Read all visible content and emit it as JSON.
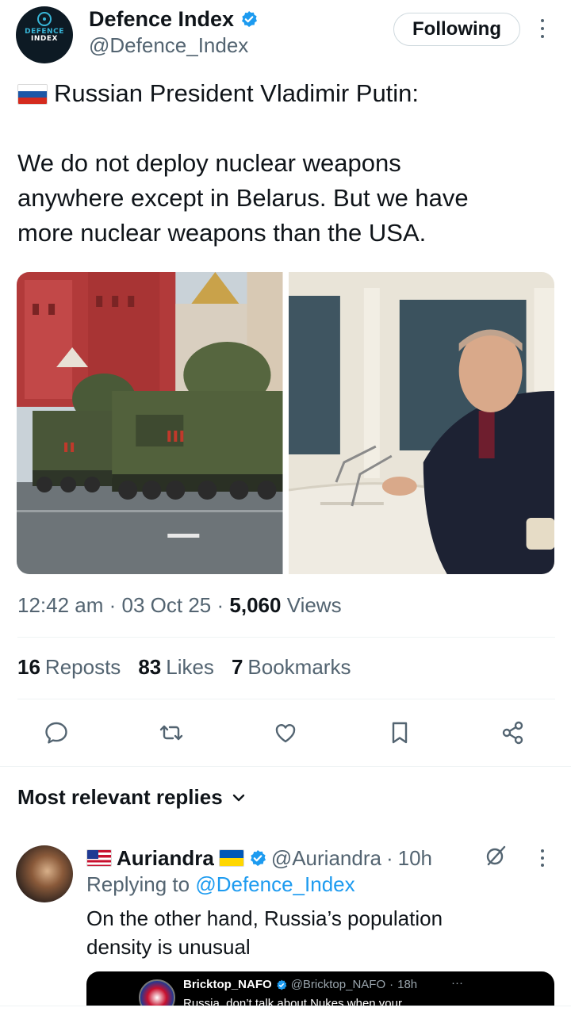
{
  "post": {
    "author": {
      "display_name": "Defence Index",
      "handle": "@Defence_Index",
      "verified": true,
      "avatar_logo_line1": "DEFENCE",
      "avatar_logo_line2": "INDEX"
    },
    "follow_button_label": "Following",
    "flag": "russia-flag",
    "text_line1": "Russian President Vladimir Putin:",
    "text_line2": "We do not deploy nuclear weapons",
    "text_line3": "anywhere except in Belarus. But we have",
    "text_line4": "more nuclear weapons than the USA.",
    "media": [
      {
        "name": "missile-launchers-red-square-photo"
      },
      {
        "name": "putin-at-desk-photo"
      }
    ],
    "time": "12:42 am",
    "date": "03 Oct 25",
    "views_count": "5,060",
    "views_label": "Views",
    "stats": {
      "reposts_count": "16",
      "reposts_label": "Reposts",
      "likes_count": "83",
      "likes_label": "Likes",
      "bookmarks_count": "7",
      "bookmarks_label": "Bookmarks"
    }
  },
  "replies_section": {
    "title": "Most relevant replies"
  },
  "reply": {
    "display_name": "Auriandra",
    "handle": "@Auriandra",
    "time": "10h",
    "replying_to_label": "Replying to",
    "replying_to_handle": "@Defence_Index",
    "text_line1": "On the other hand, Russia’s population",
    "text_line2": "density is unusual",
    "quoted": {
      "display_name": "Bricktop_NAFO",
      "handle": "@Bricktop_NAFO",
      "time": "18h",
      "text": "Russia, don’t talk about Nukes when your"
    }
  },
  "colors": {
    "accent": "#1d9bf0",
    "text_primary": "#0f1419",
    "text_secondary": "#536471",
    "divider": "#eff3f4"
  }
}
